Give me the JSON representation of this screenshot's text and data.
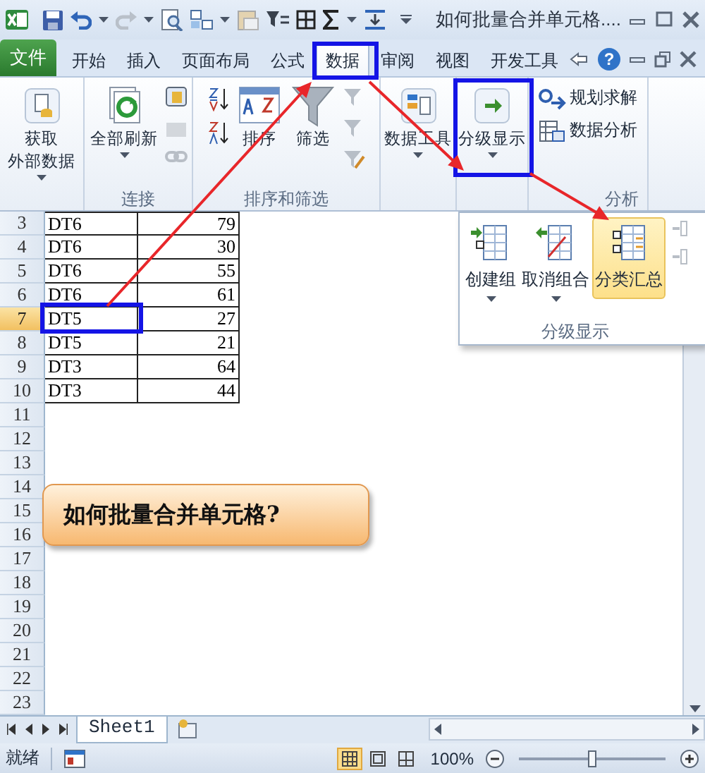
{
  "window": {
    "title": "如何批量合并单元格...."
  },
  "tabs": [
    {
      "label": "文件",
      "kind": "file",
      "selected": false
    },
    {
      "label": "开始",
      "kind": "tab",
      "selected": false
    },
    {
      "label": "插入",
      "kind": "tab",
      "selected": false
    },
    {
      "label": "页面布局",
      "kind": "tab",
      "selected": false
    },
    {
      "label": "公式",
      "kind": "tab",
      "selected": false
    },
    {
      "label": "数据",
      "kind": "tab",
      "selected": true
    },
    {
      "label": "审阅",
      "kind": "tab",
      "selected": false
    },
    {
      "label": "视图",
      "kind": "tab",
      "selected": false
    },
    {
      "label": "开发工具",
      "kind": "tab",
      "selected": false
    }
  ],
  "help": "?",
  "ribbon": {
    "groups": [
      {
        "buttons": [
          {
            "kind": "large",
            "lines": [
              "获取",
              "外部数据"
            ],
            "dropdown": true
          }
        ]
      },
      {
        "label": "连接",
        "buttons": [
          {
            "kind": "large",
            "lines": [
              "全部刷新"
            ],
            "dropdown": true
          }
        ]
      },
      {
        "label": "排序和筛选",
        "buttons": [
          {
            "kind": "large",
            "lines": [
              "排序"
            ],
            "dropdown": false
          },
          {
            "kind": "large",
            "lines": [
              "筛选"
            ],
            "dropdown": false
          }
        ]
      },
      {
        "buttons": [
          {
            "kind": "large",
            "lines": [
              "数据工具"
            ],
            "dropdown": true
          }
        ]
      },
      {
        "buttons": [
          {
            "kind": "large",
            "lines": [
              "分级显示"
            ],
            "dropdown": true
          }
        ]
      },
      {
        "label": "分析",
        "buttons": [
          {
            "kind": "small",
            "lines": [
              "规划求解"
            ],
            "dropdown": false
          },
          {
            "kind": "small",
            "lines": [
              "数据分析"
            ],
            "dropdown": false
          }
        ]
      }
    ]
  },
  "sheet": {
    "rows": [
      {
        "number": "3",
        "cells": [
          "DT6",
          "79"
        ],
        "selected": false
      },
      {
        "number": "4",
        "cells": [
          "DT6",
          "30"
        ],
        "selected": false
      },
      {
        "number": "5",
        "cells": [
          "DT6",
          "55"
        ],
        "selected": false
      },
      {
        "number": "6",
        "cells": [
          "DT6",
          "61"
        ],
        "selected": false
      },
      {
        "number": "7",
        "cells": [
          "DT5",
          "27"
        ],
        "selected": true
      },
      {
        "number": "8",
        "cells": [
          "DT5",
          "21"
        ],
        "selected": false
      },
      {
        "number": "9",
        "cells": [
          "DT3",
          "64"
        ],
        "selected": false
      },
      {
        "number": "10",
        "cells": [
          "DT3",
          "44"
        ],
        "selected": false
      },
      {
        "number": "11",
        "selected": false
      },
      {
        "number": "12",
        "selected": false
      },
      {
        "number": "13",
        "selected": false
      },
      {
        "number": "14",
        "selected": false
      },
      {
        "number": "15",
        "selected": false
      },
      {
        "number": "16",
        "selected": false
      },
      {
        "number": "17",
        "selected": false
      },
      {
        "number": "18",
        "selected": false
      },
      {
        "number": "19",
        "selected": false
      },
      {
        "number": "20",
        "selected": false
      },
      {
        "number": "21",
        "selected": false
      },
      {
        "number": "22",
        "selected": false
      },
      {
        "number": "23",
        "selected": false
      }
    ]
  },
  "outline_menu": {
    "label": "分级显示",
    "items": [
      {
        "kind": "large",
        "label": "创建组",
        "dropdown": true,
        "selected": false,
        "disabled": false
      },
      {
        "kind": "large",
        "label": "取消组合",
        "dropdown": true,
        "selected": false,
        "disabled": false
      },
      {
        "kind": "large",
        "label": "分类汇总",
        "dropdown": false,
        "selected": true,
        "disabled": false
      },
      {
        "kind": "small",
        "disabled": true
      },
      {
        "kind": "small",
        "disabled": true
      }
    ]
  },
  "callout": {
    "text": "如何批量合并单元格?"
  },
  "sheet_tabs": [
    {
      "label": "Sheet1",
      "selected": true
    }
  ],
  "status_bar": {
    "status": "就绪",
    "views": [
      {
        "selected": true
      },
      {
        "selected": false
      },
      {
        "selected": false
      }
    ],
    "zoom": "100%",
    "zoom_slider": {
      "level": 0.5
    }
  }
}
